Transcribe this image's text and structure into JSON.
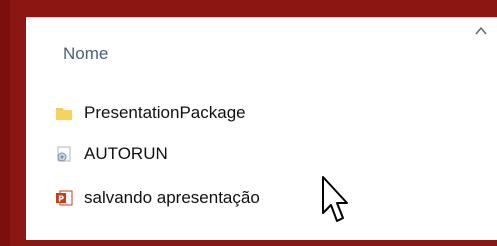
{
  "window": {
    "column_header": "Nome",
    "sort_icon": "chevron-up-icon"
  },
  "files": [
    {
      "name": "PresentationPackage",
      "icon": "folder-icon"
    },
    {
      "name": "AUTORUN",
      "icon": "system-file-icon"
    },
    {
      "name": "salvando apresentação",
      "icon": "powerpoint-file-icon"
    }
  ],
  "colors": {
    "frame": "#8c1712",
    "panel_bg": "#ffffff",
    "header_text": "#4c607a",
    "folder": "#f2c74a",
    "powerpoint": "#c43e1c"
  }
}
